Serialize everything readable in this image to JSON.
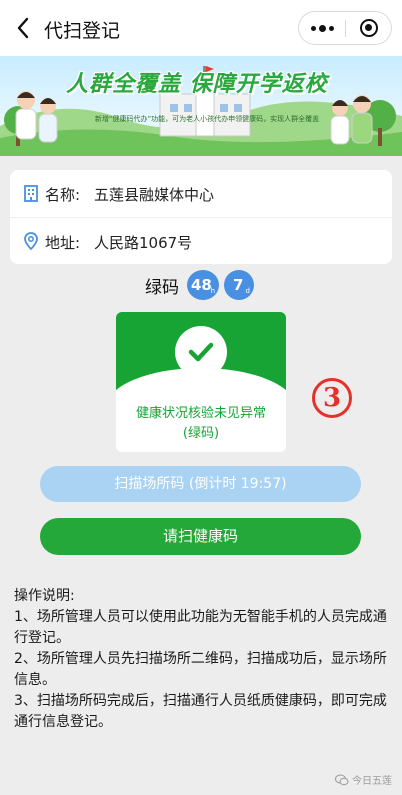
{
  "header": {
    "title": "代扫登记"
  },
  "banner": {
    "headline": "人群全覆盖  保障开学返校",
    "subline": "新增“健康码代办”功能，可为老人小孩代办申领健康码，实现人群全覆盖"
  },
  "venue": {
    "name_label": "名称:",
    "name_value": "五莲县融媒体中心",
    "address_label": "地址:",
    "address_value": "人民路1067号"
  },
  "health_code": {
    "label": "绿码",
    "badge_hours": "48",
    "badge_hours_unit": "h",
    "badge_days": "7",
    "badge_days_unit": "d",
    "status_line1": "健康状况核验未见异常",
    "status_line2": "(绿码)",
    "color": "#18a335"
  },
  "annotation": {
    "marker": "3"
  },
  "buttons": {
    "scan_place": "扫描场所码 (倒计时 19:57)",
    "scan_health": "请扫健康码"
  },
  "instructions": {
    "title": "操作说明:",
    "items": [
      "1、场所管理人员可以使用此功能为无智能手机的人员完成通行登记。",
      "2、场所管理人员先扫描场所二维码，扫描成功后，显示场所信息。",
      "3、扫描场所码完成后，扫描通行人员纸质健康码，即可完成通行信息登记。"
    ]
  },
  "watermark": {
    "text": "今日五莲"
  },
  "colors": {
    "accent_green": "#24a839",
    "accent_blue": "#4a90e2",
    "disabled_blue": "#a9d2f3",
    "marker_red": "#e6302a"
  }
}
